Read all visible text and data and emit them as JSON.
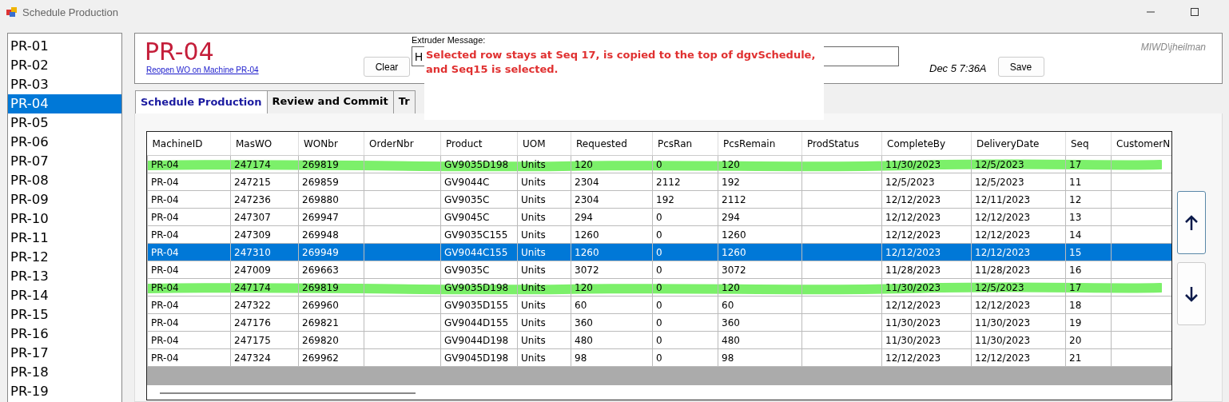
{
  "window": {
    "title": "Schedule Production"
  },
  "machines": [
    {
      "label": "PR-01",
      "selected": false
    },
    {
      "label": "PR-02",
      "selected": false
    },
    {
      "label": "PR-03",
      "selected": false
    },
    {
      "label": "PR-04",
      "selected": true
    },
    {
      "label": "PR-05",
      "selected": false
    },
    {
      "label": "PR-06",
      "selected": false
    },
    {
      "label": "PR-07",
      "selected": false
    },
    {
      "label": "PR-08",
      "selected": false
    },
    {
      "label": "PR-09",
      "selected": false
    },
    {
      "label": "PR-10",
      "selected": false
    },
    {
      "label": "PR-11",
      "selected": false
    },
    {
      "label": "PR-12",
      "selected": false
    },
    {
      "label": "PR-13",
      "selected": false
    },
    {
      "label": "PR-14",
      "selected": false
    },
    {
      "label": "PR-15",
      "selected": false
    },
    {
      "label": "PR-16",
      "selected": false
    },
    {
      "label": "PR-17",
      "selected": false
    },
    {
      "label": "PR-18",
      "selected": false
    },
    {
      "label": "PR-19",
      "selected": false
    }
  ],
  "header": {
    "machine": "PR-04",
    "reopen_link": "Reopen WO on Machine PR-04",
    "clear_button": "Clear",
    "message_label": "Extruder Message:",
    "message_value": "H",
    "timestamp": "Dec 5 7:36A",
    "save_button": "Save",
    "user": "MIWD\\jheilman"
  },
  "note": "Selected row stays at Seq 17, is copied to the top of dgvSchedule, and Seq15 is selected.",
  "tabs": [
    {
      "label": "Schedule Production",
      "selected": true
    },
    {
      "label": "Review and Commit",
      "selected": false
    },
    {
      "label": "Tr",
      "selected": false
    }
  ],
  "table": {
    "columns": [
      "MachineID",
      "MasWO",
      "WONbr",
      "OrderNbr",
      "Product",
      "UOM",
      "Requested",
      "PcsRan",
      "PcsRemain",
      "ProdStatus",
      "CompleteBy",
      "DeliveryDate",
      "Seq",
      "CustomerN"
    ],
    "rows": [
      {
        "cells": [
          "PR-04",
          "247174",
          "269819",
          "",
          "GV9035D198",
          "Units",
          "120",
          "0",
          "120",
          "",
          "11/30/2023",
          "12/5/2023",
          "17",
          ""
        ],
        "selected": false,
        "marked": true
      },
      {
        "cells": [
          "PR-04",
          "247215",
          "269859",
          "",
          "GV9044C",
          "Units",
          "2304",
          "2112",
          "192",
          "",
          "12/5/2023",
          "12/5/2023",
          "11",
          ""
        ],
        "selected": false,
        "marked": false
      },
      {
        "cells": [
          "PR-04",
          "247236",
          "269880",
          "",
          "GV9035C",
          "Units",
          "2304",
          "192",
          "2112",
          "",
          "12/12/2023",
          "12/11/2023",
          "12",
          ""
        ],
        "selected": false,
        "marked": false
      },
      {
        "cells": [
          "PR-04",
          "247307",
          "269947",
          "",
          "GV9045C",
          "Units",
          "294",
          "0",
          "294",
          "",
          "12/12/2023",
          "12/12/2023",
          "13",
          ""
        ],
        "selected": false,
        "marked": false
      },
      {
        "cells": [
          "PR-04",
          "247309",
          "269948",
          "",
          "GV9035C155",
          "Units",
          "1260",
          "0",
          "1260",
          "",
          "12/12/2023",
          "12/12/2023",
          "14",
          ""
        ],
        "selected": false,
        "marked": false
      },
      {
        "cells": [
          "PR-04",
          "247310",
          "269949",
          "",
          "GV9044C155",
          "Units",
          "1260",
          "0",
          "1260",
          "",
          "12/12/2023",
          "12/12/2023",
          "15",
          ""
        ],
        "selected": true,
        "marked": false
      },
      {
        "cells": [
          "PR-04",
          "247009",
          "269663",
          "",
          "GV9035C",
          "Units",
          "3072",
          "0",
          "3072",
          "",
          "11/28/2023",
          "11/28/2023",
          "16",
          ""
        ],
        "selected": false,
        "marked": false
      },
      {
        "cells": [
          "PR-04",
          "247174",
          "269819",
          "",
          "GV9035D198",
          "Units",
          "120",
          "0",
          "120",
          "",
          "11/30/2023",
          "12/5/2023",
          "17",
          ""
        ],
        "selected": false,
        "marked": true
      },
      {
        "cells": [
          "PR-04",
          "247322",
          "269960",
          "",
          "GV9035D155",
          "Units",
          "60",
          "0",
          "60",
          "",
          "12/12/2023",
          "12/12/2023",
          "18",
          ""
        ],
        "selected": false,
        "marked": false
      },
      {
        "cells": [
          "PR-04",
          "247176",
          "269821",
          "",
          "GV9044D155",
          "Units",
          "360",
          "0",
          "360",
          "",
          "11/30/2023",
          "11/30/2023",
          "19",
          ""
        ],
        "selected": false,
        "marked": false
      },
      {
        "cells": [
          "PR-04",
          "247175",
          "269820",
          "",
          "GV9044D198",
          "Units",
          "480",
          "0",
          "480",
          "",
          "11/30/2023",
          "11/30/2023",
          "20",
          ""
        ],
        "selected": false,
        "marked": false
      },
      {
        "cells": [
          "PR-04",
          "247324",
          "269962",
          "",
          "GV9045D198",
          "Units",
          "98",
          "0",
          "98",
          "",
          "12/12/2023",
          "12/12/2023",
          "21",
          ""
        ],
        "selected": false,
        "marked": false
      }
    ]
  }
}
